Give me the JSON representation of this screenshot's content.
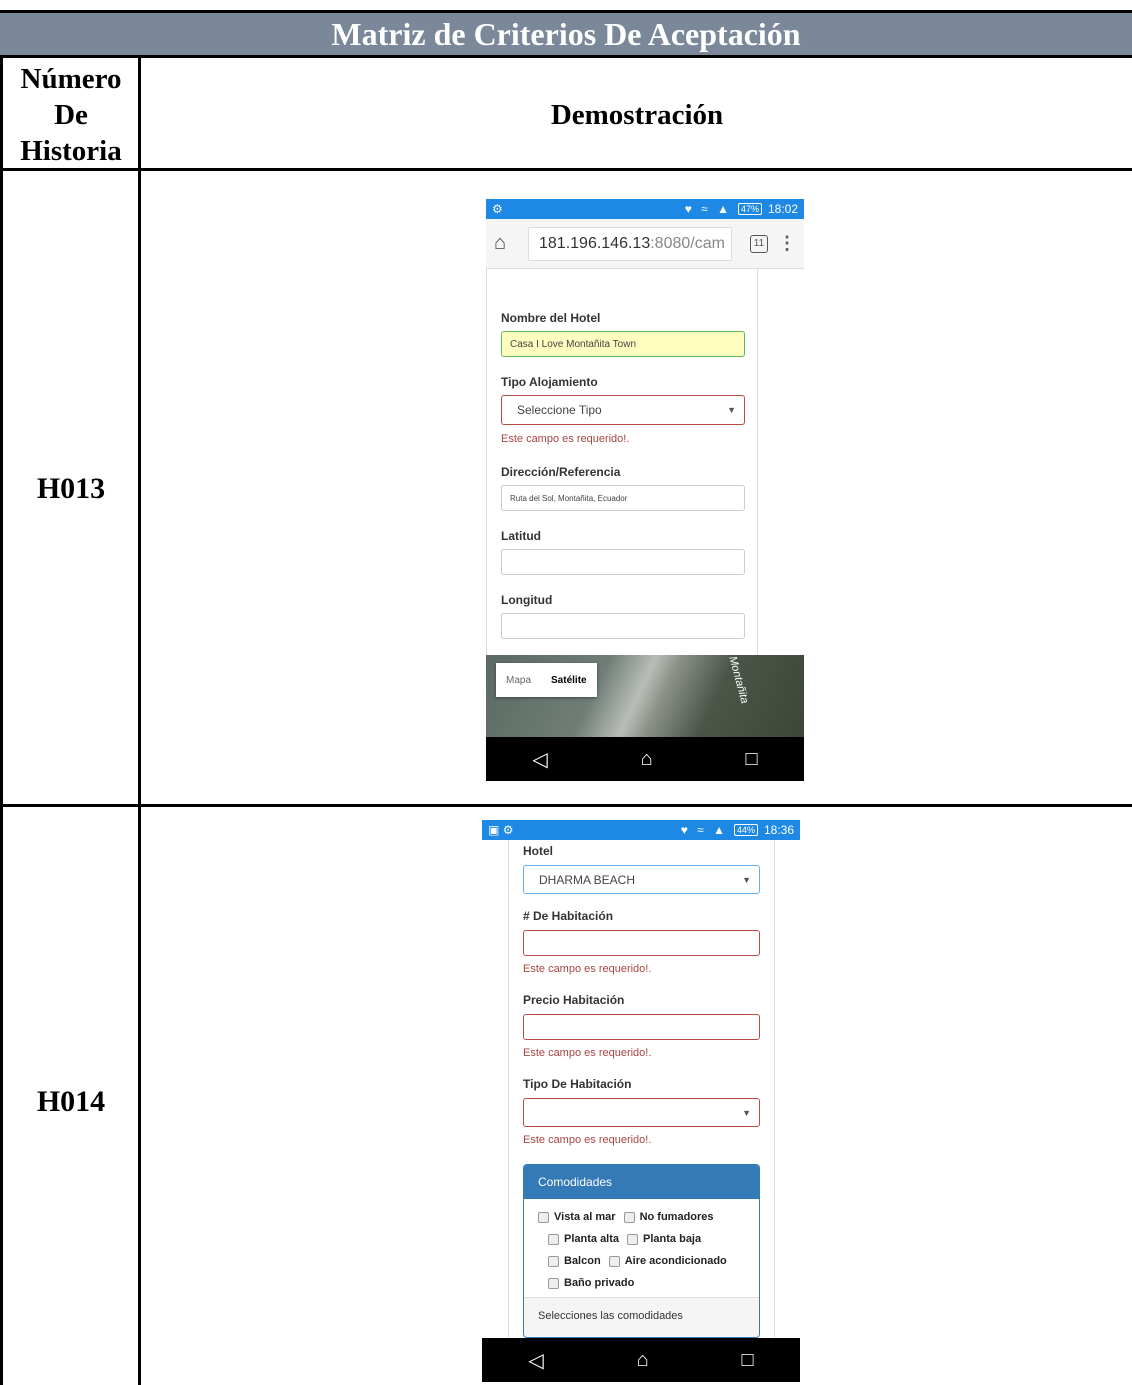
{
  "document": {
    "title": "Matriz de Criterios De Aceptación",
    "header_number": [
      "Número",
      "De",
      "Historia"
    ],
    "header_demo": "Demostración"
  },
  "rows": [
    {
      "story_id": "H013",
      "phone": {
        "status_time": "18:02",
        "battery": "47%",
        "url_host": "181.196.146.13",
        "url_rest": ":8080/cam",
        "tab_count": "11",
        "fields": {
          "hotel_name_label": "Nombre del Hotel",
          "hotel_name_value": "Casa I Love Montañita Town",
          "tipo_label": "Tipo Alojamiento",
          "tipo_value": "Seleccione Tipo",
          "tipo_error": "Este campo es requerido!.",
          "direccion_label": "Dirección/Referencia",
          "direccion_value": "Ruta del Sol, Montañita, Ecuador",
          "latitud_label": "Latitud",
          "longitud_label": "Longitud"
        },
        "map": {
          "tab_map": "Mapa",
          "tab_satellite": "Satélite",
          "place_label": "Montañita"
        }
      }
    },
    {
      "story_id": "H014",
      "phone": {
        "status_time": "18:36",
        "battery": "44%",
        "fields": {
          "hotel_label": "Hotel",
          "hotel_value": "DHARMA BEACH",
          "room_no_label": "# De Habitación",
          "room_no_error": "Este campo es requerido!.",
          "price_label": "Precio Habitación",
          "price_error": "Este campo es requerido!.",
          "room_type_label": "Tipo De Habitación",
          "room_type_error": "Este campo es requerido!."
        },
        "amenities": {
          "title": "Comodidades",
          "items": [
            "Vista al mar",
            "No fumadores",
            "Planta alta",
            "Planta baja",
            "Balcon",
            "Aire acondicionado",
            "Baño privado"
          ],
          "footer": "Selecciones las comodidades"
        }
      }
    }
  ],
  "icons": [
    "home-icon",
    "menu-icon",
    "tabs-icon",
    "back-icon",
    "home-nav-icon",
    "recents-icon",
    "checkbox-icon",
    "caret-down-icon"
  ],
  "colors": {
    "title_bar": "#7a8899",
    "status_bar": "#1e88e5",
    "panel_primary": "#337ab7",
    "error": "#a94442",
    "highlight_field": "#fdfdbf"
  }
}
